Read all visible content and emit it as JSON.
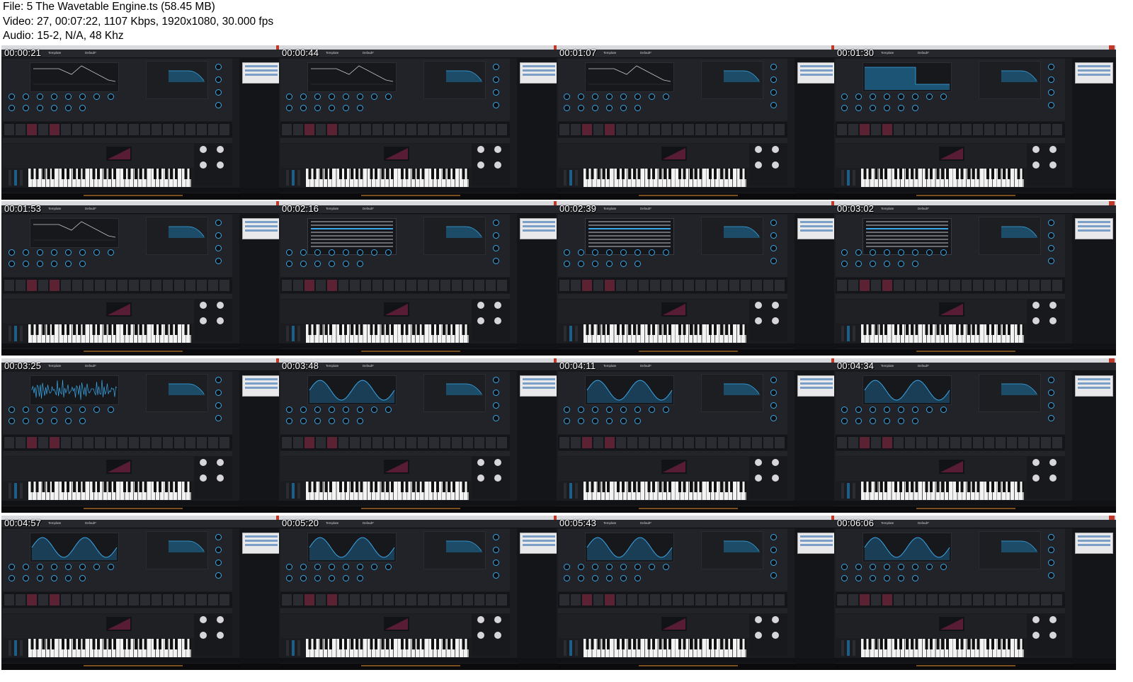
{
  "header": {
    "file_line": "File: 5  The Wavetable Engine.ts (58.45 MB)",
    "video_line": "Video: 27, 00:07:22, 1107 Kbps, 1920x1080, 30.000 fps",
    "audio_line": "Audio: 15-2, N/A, 48 Khz"
  },
  "tiles": [
    {
      "timestamp": "00:00:21",
      "template": "Template",
      "preset": "Default*",
      "wave": "ramp",
      "menu": false
    },
    {
      "timestamp": "00:00:44",
      "template": "Template",
      "preset": "Default*",
      "wave": "ramp",
      "menu": false
    },
    {
      "timestamp": "00:01:07",
      "template": "Template",
      "preset": "Default*",
      "wave": "ramp",
      "menu": false
    },
    {
      "timestamp": "00:01:30",
      "template": "Template",
      "preset": "Default*",
      "wave": "square",
      "menu": false
    },
    {
      "timestamp": "00:01:53",
      "template": "Template",
      "preset": "Default*",
      "wave": "ramp",
      "menu": false
    },
    {
      "timestamp": "00:02:16",
      "template": "Template",
      "preset": "Default*",
      "wave": "none",
      "menu": true
    },
    {
      "timestamp": "00:02:39",
      "template": "Template",
      "preset": "Default*",
      "wave": "none",
      "menu": true
    },
    {
      "timestamp": "00:03:02",
      "template": "Template",
      "preset": "Default*",
      "wave": "none",
      "menu": true
    },
    {
      "timestamp": "00:03:25",
      "template": "Template",
      "preset": "Default*",
      "wave": "noise",
      "menu": false
    },
    {
      "timestamp": "00:03:48",
      "template": "Template",
      "preset": "Default*",
      "wave": "sine",
      "menu": false
    },
    {
      "timestamp": "00:04:11",
      "template": "Template",
      "preset": "Default*",
      "wave": "sine",
      "menu": false
    },
    {
      "timestamp": "00:04:34",
      "template": "Template",
      "preset": "Default*",
      "wave": "sine",
      "menu": false
    },
    {
      "timestamp": "00:04:57",
      "template": "Template",
      "preset": "Default*",
      "wave": "sine",
      "menu": false
    },
    {
      "timestamp": "00:05:20",
      "template": "Template",
      "preset": "Default*",
      "wave": "sine",
      "menu": false
    },
    {
      "timestamp": "00:05:43",
      "template": "Template",
      "preset": "Default*",
      "wave": "sine",
      "menu": false
    },
    {
      "timestamp": "00:06:06",
      "template": "Template",
      "preset": "Default*",
      "wave": "sine",
      "menu": false
    }
  ],
  "colors": {
    "accent": "#3aa8e8",
    "background": "#1b1c20",
    "page": "#ffffff"
  }
}
